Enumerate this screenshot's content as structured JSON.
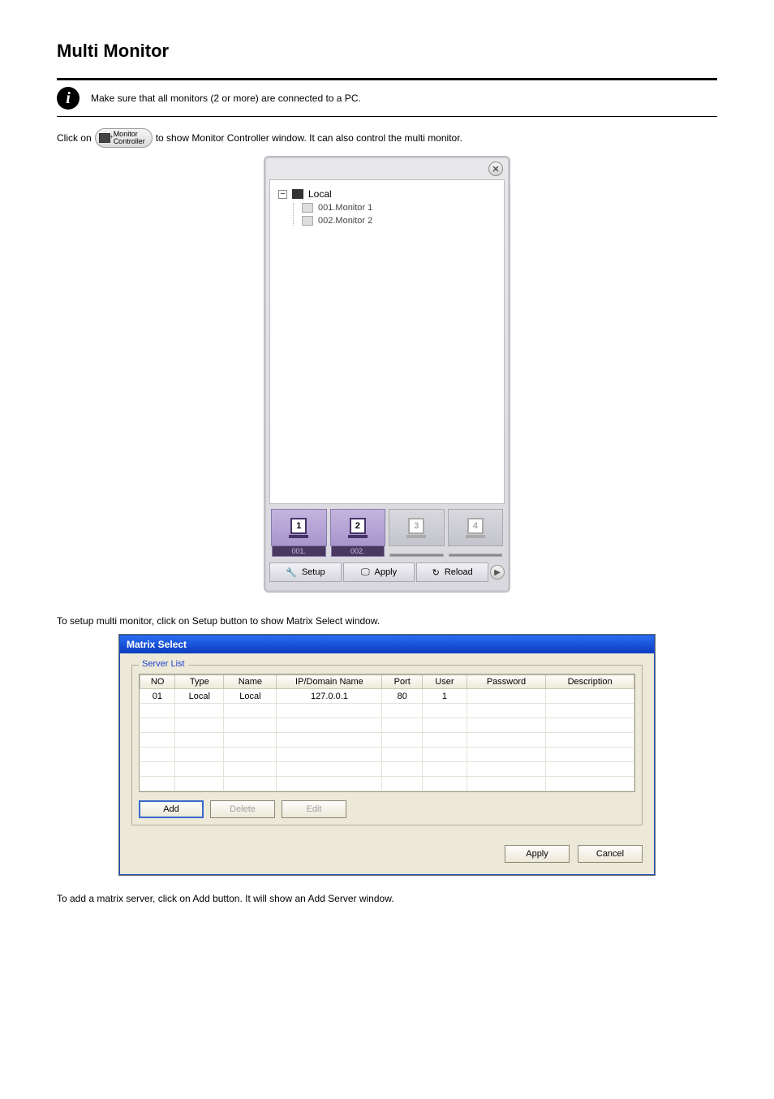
{
  "page": {
    "title": "Multi Monitor",
    "info_note": "Make sure that all monitors (2 or more) are connected to a PC.",
    "paragraph1_prefix": "Click on",
    "mc_button": {
      "line1": "Monitor",
      "line2": "Controller"
    },
    "paragraph1_suffix": "to show Monitor Controller window. It can also control the multi monitor.",
    "paragraph2": "To setup multi monitor, click on Setup button to show Matrix Select window.",
    "paragraph3": "To add a matrix server, click on Add button. It will show an Add Server window."
  },
  "monitor_controller": {
    "close": "✕",
    "tree_root": "Local",
    "tree_children": [
      "001.Monitor 1",
      "002.Monitor 2"
    ],
    "slots": [
      {
        "num": "1",
        "label": "001.",
        "enabled": true
      },
      {
        "num": "2",
        "label": "002.",
        "enabled": true
      },
      {
        "num": "3",
        "label": "",
        "enabled": false
      },
      {
        "num": "4",
        "label": "",
        "enabled": false
      }
    ],
    "actions": {
      "setup": "Setup",
      "apply": "Apply",
      "reload": "Reload"
    }
  },
  "matrix_select": {
    "title": "Matrix Select",
    "server_list_label": "Server List",
    "columns": [
      "NO",
      "Type",
      "Name",
      "IP/Domain Name",
      "Port",
      "User",
      "Password",
      "Description"
    ],
    "rows": [
      {
        "NO": "01",
        "Type": "Local",
        "Name": "Local",
        "IP": "127.0.0.1",
        "Port": "80",
        "User": "1",
        "Password": "",
        "Description": ""
      }
    ],
    "buttons": {
      "add": "Add",
      "delete": "Delete",
      "edit": "Edit"
    },
    "footer": {
      "apply": "Apply",
      "cancel": "Cancel"
    }
  }
}
